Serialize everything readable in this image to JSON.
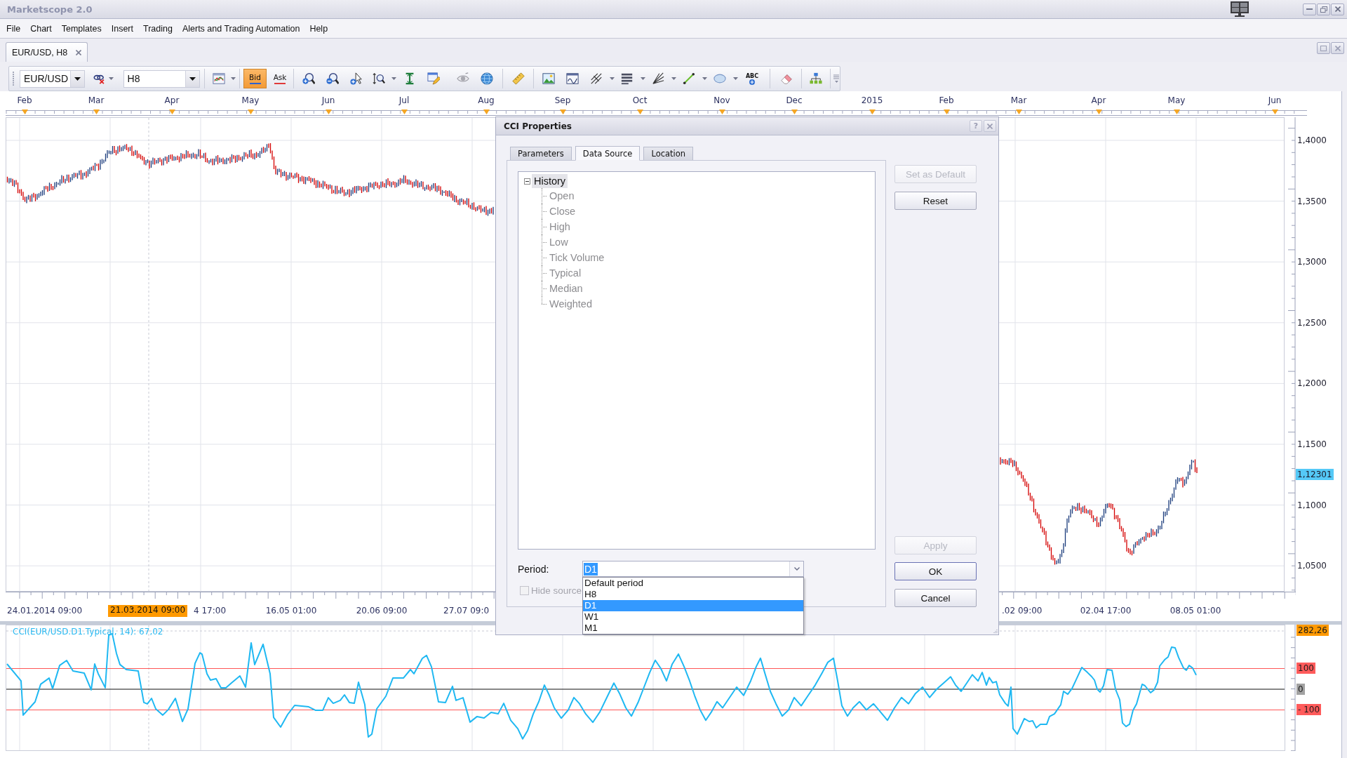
{
  "window": {
    "title": "Marketscope 2.0"
  },
  "menu": [
    "File",
    "Chart",
    "Templates",
    "Insert",
    "Trading",
    "Alerts and Trading Automation",
    "Help"
  ],
  "document_tabs": [
    {
      "label": "EUR/USD, H8",
      "selected": true
    }
  ],
  "toolbar": {
    "instrument": "EUR/USD",
    "timeframe": "H8",
    "price_buttons": [
      {
        "label": "Bid",
        "selected": true,
        "color": "#2f62d0"
      },
      {
        "label": "Ask",
        "selected": false,
        "color": "#e03a3a"
      }
    ],
    "text_tool": "ABC"
  },
  "chart": {
    "month_axis": [
      "Feb",
      "Mar",
      "Apr",
      "May",
      "Jun",
      "Jul",
      "Aug",
      "Sep",
      "Oct",
      "Nov",
      "Dec",
      "2015",
      "Feb",
      "Mar",
      "Apr",
      "May",
      "Jun"
    ],
    "price_axis": [
      "1,4000",
      "1,3500",
      "1,3000",
      "1,2500",
      "1,2000",
      "1,1500",
      "1,1000",
      "1,0500"
    ],
    "current_price": "1,12301",
    "time_axis": [
      "24.01.2014 09:00",
      "4 17:00",
      "16.05 01:00",
      "20.06 09:00",
      "27.07 09:0",
      ".02 09:00",
      "02.04 17:00",
      "08.05 01:00"
    ],
    "cursor_time": "21.03.2014 09:00"
  },
  "indicator_panel": {
    "legend": "CCI(EUR/USD.D1.Typical, 14): 67,02",
    "cursor_value": "282,26",
    "levels": [
      {
        "label": "100",
        "kind": "bound"
      },
      {
        "label": "0",
        "kind": "zero"
      },
      {
        "label": "- 100",
        "kind": "bound"
      }
    ]
  },
  "dialog": {
    "title": "CCI Properties",
    "help_button": "?",
    "tabs": [
      {
        "label": "Parameters",
        "selected": false
      },
      {
        "label": "Data Source",
        "selected": true
      },
      {
        "label": "Location",
        "selected": false
      }
    ],
    "source_tree": [
      {
        "label": "History",
        "selected": true,
        "disabled": false,
        "expanded": true,
        "children": [
          {
            "label": "Open",
            "selected": false,
            "disabled": true
          },
          {
            "label": "Close",
            "selected": false,
            "disabled": true
          },
          {
            "label": "High",
            "selected": false,
            "disabled": true
          },
          {
            "label": "Low",
            "selected": false,
            "disabled": true
          },
          {
            "label": "Tick Volume",
            "selected": false,
            "disabled": true
          },
          {
            "label": "Typical",
            "selected": false,
            "disabled": true
          },
          {
            "label": "Median",
            "selected": false,
            "disabled": true
          },
          {
            "label": "Weighted",
            "selected": false,
            "disabled": true
          }
        ]
      }
    ],
    "period": {
      "label": "Period:",
      "value": "D1",
      "expanded": true,
      "options": [
        {
          "label": "Default period",
          "selected": false
        },
        {
          "label": "H8",
          "selected": false
        },
        {
          "label": "D1",
          "selected": true
        },
        {
          "label": "W1",
          "selected": false
        },
        {
          "label": "M1",
          "selected": false
        }
      ]
    },
    "hide_source": {
      "label": "Hide source",
      "checked": false,
      "disabled": true
    },
    "side_buttons": [
      {
        "label": "Set as Default",
        "disabled": true
      },
      {
        "label": "Reset",
        "disabled": false
      }
    ],
    "action_buttons": [
      {
        "label": "Apply",
        "disabled": true,
        "default": false
      },
      {
        "label": "OK",
        "disabled": false,
        "default": true
      },
      {
        "label": "Cancel",
        "disabled": false,
        "default": false
      }
    ]
  }
}
